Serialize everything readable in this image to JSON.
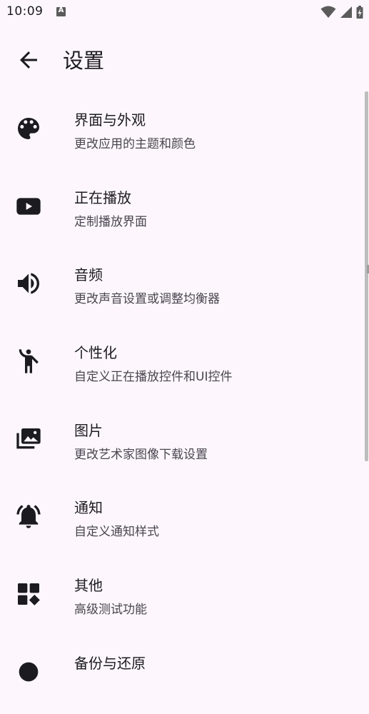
{
  "status": {
    "time": "10:09",
    "notif_letter": "A"
  },
  "header": {
    "title": "设置"
  },
  "items": [
    {
      "title": "界面与外观",
      "subtitle": "更改应用的主题和颜色",
      "icon": "palette-icon"
    },
    {
      "title": "正在播放",
      "subtitle": "定制播放界面",
      "icon": "play-icon"
    },
    {
      "title": "音频",
      "subtitle": "更改声音设置或调整均衡器",
      "icon": "volume-icon"
    },
    {
      "title": "个性化",
      "subtitle": "自定义正在播放控件和UI控件",
      "icon": "accessibility-icon"
    },
    {
      "title": "图片",
      "subtitle": "更改艺术家图像下载设置",
      "icon": "image-icon"
    },
    {
      "title": "通知",
      "subtitle": "自定义通知样式",
      "icon": "bell-icon"
    },
    {
      "title": "其他",
      "subtitle": "高级测试功能",
      "icon": "widgets-icon"
    },
    {
      "title": "备份与还原",
      "subtitle": "",
      "icon": "backup-icon"
    }
  ],
  "colors": {
    "background": "#fdf7fd",
    "icon": "#1c1b1f",
    "secondary_text": "#49454f"
  }
}
